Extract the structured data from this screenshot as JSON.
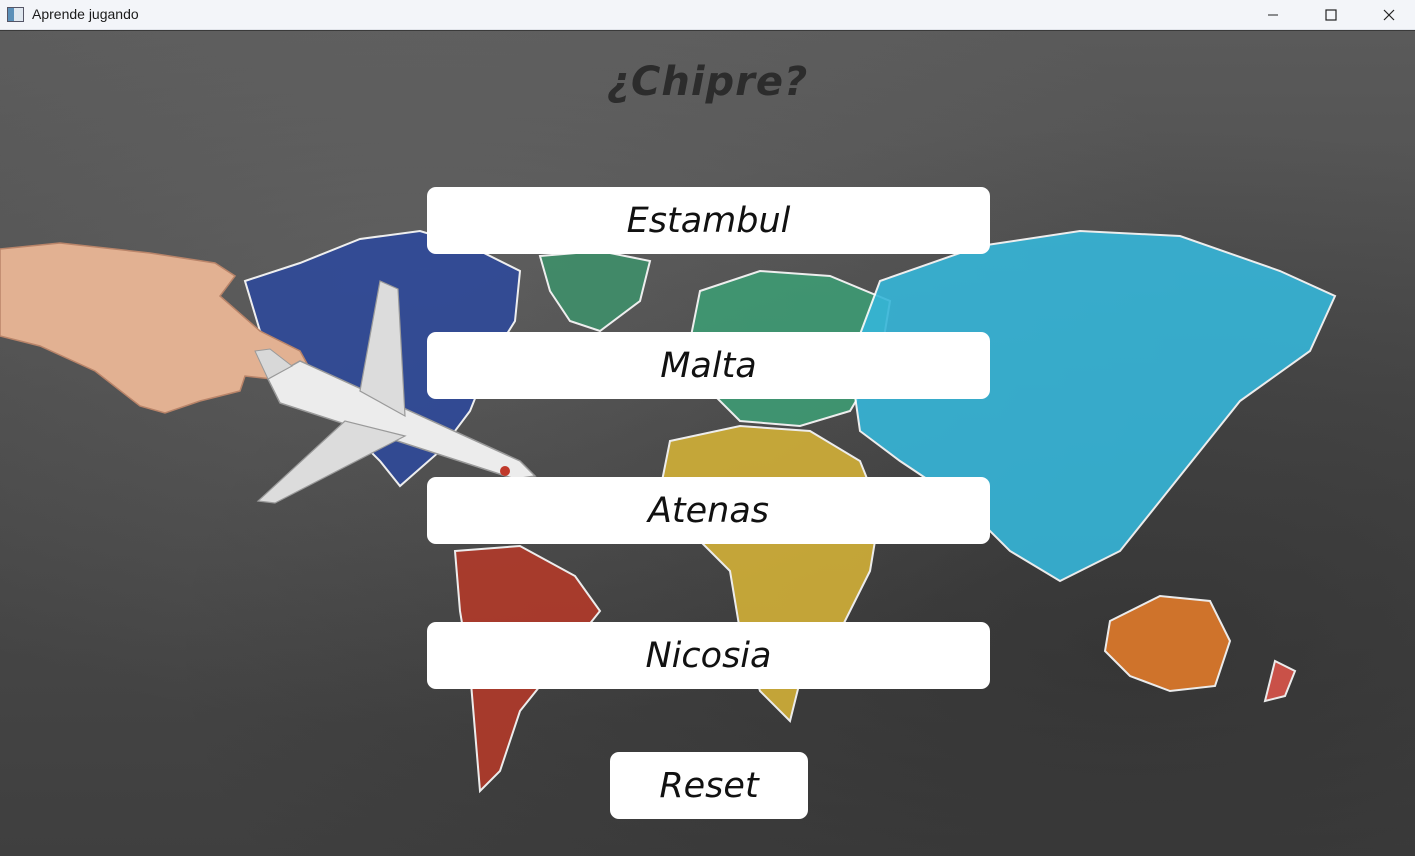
{
  "window": {
    "title": "Aprende jugando",
    "controls": [
      "minimize-icon",
      "maximize-icon",
      "close-icon"
    ]
  },
  "game": {
    "question": "¿Chipre?",
    "answers": [
      {
        "label": "Estambul"
      },
      {
        "label": "Malta"
      },
      {
        "label": "Atenas"
      },
      {
        "label": "Nicosia"
      }
    ],
    "reset_label": "Reset"
  },
  "colors": {
    "board": "#4b4b4b",
    "button_bg": "#ffffff",
    "question_text": "#2c2c2c"
  }
}
